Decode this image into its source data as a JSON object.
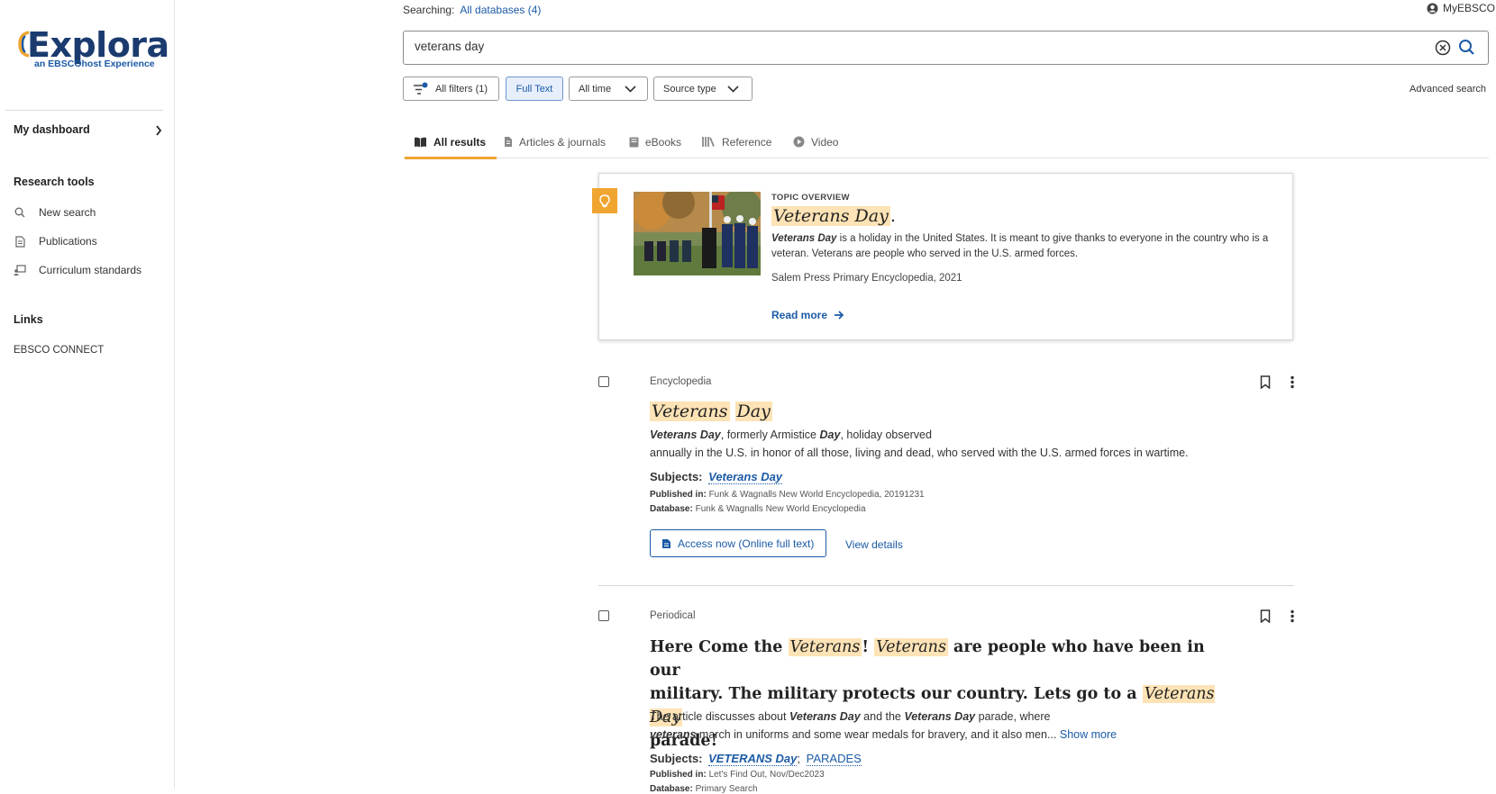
{
  "brand": {
    "name": "Explora",
    "tagline": "an EBSCOhost Experience",
    "colors": {
      "navy": "#1b3b6f",
      "accent_orange": "#f0a531",
      "link_blue": "#1b5aa6",
      "highlight": "#fde3b5"
    }
  },
  "sidebar": {
    "dashboard": "My dashboard",
    "research_tools_heading": "Research tools",
    "tools": [
      {
        "label": "New search",
        "icon": "search-icon"
      },
      {
        "label": "Publications",
        "icon": "document-icon"
      },
      {
        "label": "Curriculum standards",
        "icon": "curriculum-icon"
      }
    ],
    "links_heading": "Links",
    "links": [
      {
        "label": "EBSCO CONNECT"
      }
    ]
  },
  "header": {
    "searching_label": "Searching:",
    "databases": "All databases (4)",
    "account": "MyEBSCO"
  },
  "search": {
    "query": "veterans day"
  },
  "filters": {
    "all_filters": "All filters (1)",
    "full_text": "Full Text",
    "time": "All time",
    "source_type": "Source type",
    "advanced": "Advanced search"
  },
  "tabs": [
    {
      "label": "All results",
      "icon": "book-open-icon",
      "active": true
    },
    {
      "label": "Articles & journals",
      "icon": "article-icon",
      "active": false
    },
    {
      "label": "eBooks",
      "icon": "ebook-icon",
      "active": false
    },
    {
      "label": "Reference",
      "icon": "reference-icon",
      "active": false
    },
    {
      "label": "Video",
      "icon": "play-icon",
      "active": false
    }
  ],
  "topic": {
    "eyebrow": "TOPIC OVERVIEW",
    "title_highlight": "Veterans Day",
    "title_suffix": ".",
    "desc_highlight": "Veterans Day",
    "desc_rest": " is a holiday in the United States. It is meant to give thanks to everyone in the country who is a veteran. Veterans are people who served in the U.S. armed forces.",
    "source": "Salem Press Primary Encyclopedia, 2021",
    "read_more": "Read more"
  },
  "results": [
    {
      "type": "Encyclopedia",
      "title_parts": [
        "Veterans",
        "Day"
      ],
      "abstract_line1_bold1": "Veterans Day",
      "abstract_line1_mid": ", formerly Armistice ",
      "abstract_line1_bold2": "Day",
      "abstract_line1_end": ", holiday observed",
      "abstract_line2": "annually in the U.S. in honor of all those, living and dead, who served with the U.S. armed forces in wartime.",
      "subjects_label": "Subjects:",
      "subjects": [
        "Veterans Day"
      ],
      "published_label": "Published in:",
      "published": "Funk & Wagnalls New World Encyclopedia, 20191231",
      "database_label": "Database:",
      "database": "Funk & Wagnalls New World Encyclopedia",
      "access": "Access now (Online full text)",
      "details": "View details"
    },
    {
      "type": "Periodical",
      "title_a": "Here Come the ",
      "title_h1": "Veterans",
      "title_b": "! ",
      "title_h2": "Veterans",
      "title_c": " are people who have been in our",
      "title_d": "military. The military protects our country. Lets go to a ",
      "title_h3": "Veterans Day",
      "title_e": "parade!",
      "abs_a": "The article discusses about ",
      "abs_b1": "Veterans Day",
      "abs_c": " and the ",
      "abs_b2": "Veterans Day",
      "abs_d": " parade, where",
      "abs_b3": "veterans",
      "abs_e": " march in uniforms and some wear medals for bravery, and it also men...",
      "show_more": "Show more",
      "subjects_label": "Subjects:",
      "subjects": [
        "VETERANS Day",
        "PARADES"
      ],
      "published_label": "Published in:",
      "published": "Let's Find Out, Nov/Dec2023",
      "database_label": "Database:",
      "database": "Primary Search"
    }
  ]
}
